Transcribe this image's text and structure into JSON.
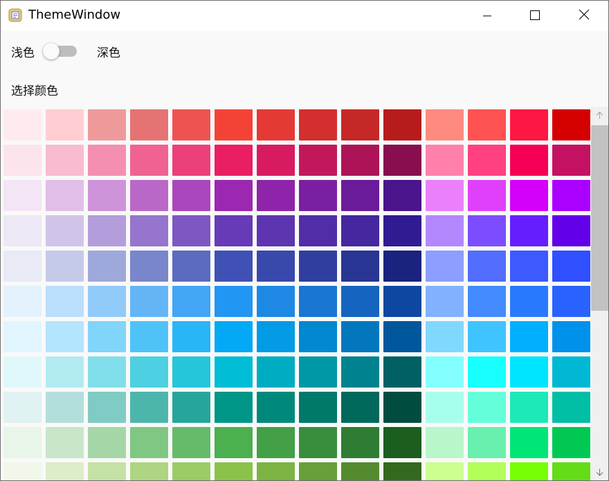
{
  "window": {
    "title": "ThemeWindow",
    "icon": "app-icon",
    "controls": [
      "minimize-icon",
      "maximize-icon",
      "close-icon"
    ]
  },
  "theme": {
    "light_label": "浅色",
    "dark_label": "深色",
    "toggle_on": false
  },
  "section": {
    "label": "选择颜色"
  },
  "scrollbar": {
    "up_icon": "arrow-up-icon",
    "down_icon": "arrow-down-icon"
  },
  "palette": {
    "rows": [
      [
        "#FFEBEE",
        "#FFCDD2",
        "#EF9A9A",
        "#E57373",
        "#EF5350",
        "#F44336",
        "#E53935",
        "#D32F2F",
        "#C62828",
        "#B71C1C",
        "#FF8A80",
        "#FF5252",
        "#FF1744",
        "#D50000"
      ],
      [
        "#FCE4EC",
        "#F8BBD0",
        "#F48FB1",
        "#F06292",
        "#EC407A",
        "#E91E63",
        "#D81B60",
        "#C2185B",
        "#AD1457",
        "#880E4F",
        "#FF80AB",
        "#FF4081",
        "#F50057",
        "#C51162"
      ],
      [
        "#F3E5F5",
        "#E1BEE7",
        "#CE93D8",
        "#BA68C8",
        "#AB47BC",
        "#9C27B0",
        "#8E24AA",
        "#7B1FA2",
        "#6A1B9A",
        "#4A148C",
        "#EA80FC",
        "#E040FB",
        "#D500F9",
        "#AA00FF"
      ],
      [
        "#EDE7F6",
        "#D1C4E9",
        "#B39DDB",
        "#9575CD",
        "#7E57C2",
        "#673AB7",
        "#5E35B1",
        "#512DA8",
        "#4527A0",
        "#311B92",
        "#B388FF",
        "#7C4DFF",
        "#651FFF",
        "#6200EA"
      ],
      [
        "#E8EAF6",
        "#C5CAE9",
        "#9FA8DA",
        "#7986CB",
        "#5C6BC0",
        "#3F51B5",
        "#3949AB",
        "#303F9F",
        "#283593",
        "#1A237E",
        "#8C9EFF",
        "#536DFE",
        "#3D5AFE",
        "#304FFE"
      ],
      [
        "#E3F2FD",
        "#BBDEFB",
        "#90CAF9",
        "#64B5F6",
        "#42A5F5",
        "#2196F3",
        "#1E88E5",
        "#1976D2",
        "#1565C0",
        "#0D47A1",
        "#82B1FF",
        "#448AFF",
        "#2979FF",
        "#2962FF"
      ],
      [
        "#E1F5FE",
        "#B3E5FC",
        "#81D4FA",
        "#4FC3F7",
        "#29B6F6",
        "#03A9F4",
        "#039BE5",
        "#0288D1",
        "#0277BD",
        "#01579B",
        "#80D8FF",
        "#40C4FF",
        "#00B0FF",
        "#0091EA"
      ],
      [
        "#E0F7FA",
        "#B2EBF2",
        "#80DEEA",
        "#4DD0E1",
        "#26C6DA",
        "#00BCD4",
        "#00ACC1",
        "#0097A7",
        "#00838F",
        "#006064",
        "#84FFFF",
        "#18FFFF",
        "#00E5FF",
        "#00B8D4"
      ],
      [
        "#E0F2F1",
        "#B2DFDB",
        "#80CBC4",
        "#4DB6AC",
        "#26A69A",
        "#009688",
        "#00897B",
        "#00796B",
        "#00695C",
        "#004D40",
        "#A7FFEB",
        "#64FFDA",
        "#1DE9B6",
        "#00BFA5"
      ],
      [
        "#E8F5E9",
        "#C8E6C9",
        "#A5D6A7",
        "#81C784",
        "#66BB6A",
        "#4CAF50",
        "#43A047",
        "#388E3C",
        "#2E7D32",
        "#1B5E20",
        "#B9F6CA",
        "#69F0AE",
        "#00E676",
        "#00C853"
      ],
      [
        "#F1F8E9",
        "#DCEDC8",
        "#C5E1A5",
        "#AED581",
        "#9CCC65",
        "#8BC34A",
        "#7CB342",
        "#689F38",
        "#558B2F",
        "#33691E",
        "#CCFF90",
        "#B2FF59",
        "#76FF03",
        "#64DD17"
      ]
    ]
  }
}
